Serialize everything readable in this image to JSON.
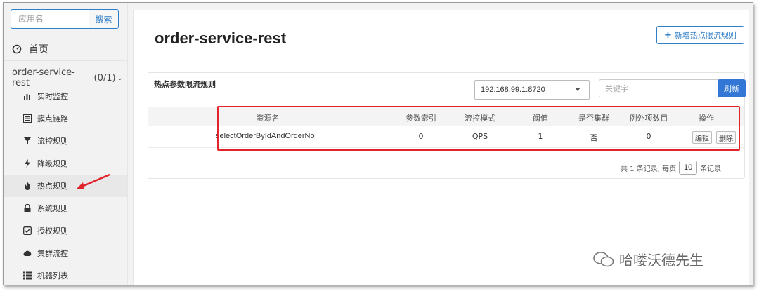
{
  "sidebar": {
    "search_placeholder": "应用名",
    "search_button": "搜索",
    "home": "首页",
    "app_name": "order-service-rest",
    "app_count": "(0/1)",
    "menu": [
      {
        "label": "实时监控",
        "icon": "bar-chart-icon"
      },
      {
        "label": "簇点链路",
        "icon": "list-icon"
      },
      {
        "label": "流控规则",
        "icon": "filter-icon"
      },
      {
        "label": "降级规则",
        "icon": "bolt-icon"
      },
      {
        "label": "热点规则",
        "icon": "fire-icon"
      },
      {
        "label": "系统规则",
        "icon": "lock-icon"
      },
      {
        "label": "授权规则",
        "icon": "check-square-icon"
      },
      {
        "label": "集群流控",
        "icon": "cloud-icon"
      },
      {
        "label": "机器列表",
        "icon": "server-list-icon"
      }
    ]
  },
  "main": {
    "title": "order-service-rest",
    "add_button": "新增热点限流规则",
    "card_title": "热点参数限流规则",
    "ip_selected": "192.168.99.1:8720",
    "keyword_placeholder": "关键字",
    "refresh_button": "刷新",
    "columns": [
      "资源名",
      "参数索引",
      "流控模式",
      "阈值",
      "是否集群",
      "例外项数目",
      "操作"
    ],
    "rows": [
      {
        "resource": "selectOrderByIdAndOrderNo",
        "param_index": "0",
        "mode": "QPS",
        "threshold": "1",
        "cluster": "否",
        "exceptions": "0",
        "edit": "编辑",
        "delete": "删除"
      }
    ],
    "pager": {
      "prefix": "共 1 条记录, 每页",
      "page_size": "10",
      "suffix": "条记录"
    }
  },
  "watermark": "哈喽沃德先生",
  "colors": {
    "accent": "#2f7ec7",
    "refresh": "#3277d5",
    "highlight": "#e0242a"
  }
}
